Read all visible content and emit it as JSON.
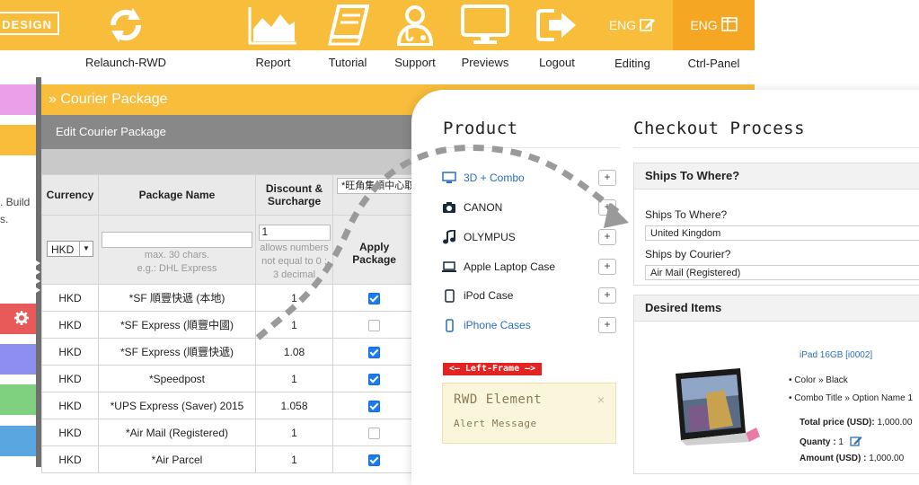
{
  "topnav": {
    "logo_text": "DESIGN",
    "items": [
      {
        "label": "Relaunch-RWD",
        "icon": "refresh-icon"
      },
      {
        "label": "Report",
        "icon": "area-chart-icon"
      },
      {
        "label": "Tutorial",
        "icon": "book-icon"
      },
      {
        "label": "Support",
        "icon": "doctor-icon"
      },
      {
        "label": "Previews",
        "icon": "monitor-icon"
      },
      {
        "label": "Logout",
        "icon": "logout-icon"
      }
    ],
    "tabs": [
      {
        "head": "ENG",
        "label": "Editing",
        "icon": "edit-icon"
      },
      {
        "head": "ENG",
        "label": "Ctrl-Panel",
        "icon": "panel-icon"
      }
    ]
  },
  "left_strip": {
    "text_1": ". Build",
    "text_2": "s.",
    "colors": [
      "#e9a0e9",
      "#f8bd3b",
      "#e85a5a",
      "#8e8ef0",
      "#7fd17f",
      "#59a6e0"
    ]
  },
  "courier": {
    "title": "» Courier Package",
    "subtitle": "Edit Courier Package",
    "columns": [
      "Currency",
      "Package Name",
      "Discount & Surcharge",
      "*旺角集領中心取"
    ],
    "filter": {
      "currency": "HKD",
      "name_hint_1": "max. 30 chars.",
      "name_hint_2": "e.g.: DHL Express",
      "discount_value": "1",
      "discount_hint_1": "allows numbers",
      "discount_hint_2": "not equal to 0 ;",
      "discount_hint_3": "3 decimal",
      "apply_label_1": "Apply",
      "apply_label_2": "Package"
    },
    "rows": [
      {
        "currency": "HKD",
        "name": "*SF 順豐快遞 (本地)",
        "discount": "1",
        "apply": true
      },
      {
        "currency": "HKD",
        "name": "*SF Express (順豐中國)",
        "discount": "1",
        "apply": false
      },
      {
        "currency": "HKD",
        "name": "*SF Express (順豐快遞)",
        "discount": "1.08",
        "apply": true
      },
      {
        "currency": "HKD",
        "name": "*Speedpost",
        "discount": "1",
        "apply": true
      },
      {
        "currency": "HKD",
        "name": "*UPS Express (Saver) 2015",
        "discount": "1.058",
        "apply": true
      },
      {
        "currency": "HKD",
        "name": "*Air Mail (Registered)",
        "discount": "1",
        "apply": false
      },
      {
        "currency": "HKD",
        "name": "*Air Parcel",
        "discount": "1",
        "apply": true
      }
    ]
  },
  "product": {
    "title": "Product",
    "items": [
      {
        "label": "3D + Combo",
        "icon": "monitor-icon",
        "highlight": true
      },
      {
        "label": "CANON",
        "icon": "camera-icon",
        "highlight": false
      },
      {
        "label": "OLYMPUS",
        "icon": "music-icon",
        "highlight": false
      },
      {
        "label": "Apple Laptop Case",
        "icon": "laptop-icon",
        "highlight": false
      },
      {
        "label": "iPod Case",
        "icon": "tablet-icon",
        "highlight": false
      },
      {
        "label": "iPhone Cases",
        "icon": "phone-icon",
        "highlight": true
      }
    ],
    "plus": "+",
    "left_frame_tag": "<— Left-Frame —>",
    "alert_title": "RWD Element",
    "alert_message": "Alert Message",
    "alert_close": "×"
  },
  "checkout": {
    "title": "Checkout Process",
    "ships_section": "Ships To Where?",
    "ships_label": "Ships To Where?",
    "ships_value": "United Kingdom",
    "courier_label": "Ships by Courier?",
    "courier_value": "Air Mail (Registered)",
    "desired_section": "Desired Items",
    "item_name": "iPad 16GB [i0002]",
    "item_color": "Color » Black",
    "item_combo": "Combo Title » Option Name 1",
    "total_label": "Total price (USD):",
    "total_value": "1,000.00",
    "quantity_label": "Quanty :",
    "quantity_value": "1",
    "amount_label": "Amount (USD) :",
    "amount_value": "1,000.00"
  },
  "colors": {
    "accent": "#f8bd3b",
    "accent_dark": "#f5a623",
    "link_blue": "#2a6fb8",
    "checkbox_blue": "#1a7cf5",
    "tag_red": "#e52222"
  }
}
